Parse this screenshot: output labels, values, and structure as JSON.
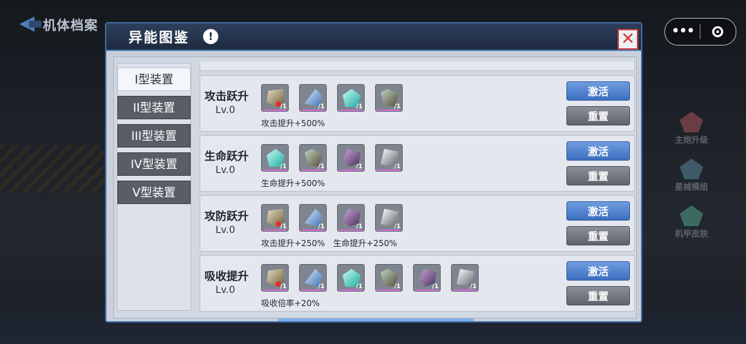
{
  "back": {
    "label": "机体档案"
  },
  "capsule": {
    "more_label": "•••"
  },
  "side_menu": [
    {
      "label": "主炮升级",
      "icon": "cannon-icon",
      "color": "#6a3d45"
    },
    {
      "label": "星械模组",
      "icon": "module-icon",
      "color": "#3f5a68"
    },
    {
      "label": "机甲皮肤",
      "icon": "skin-icon",
      "color": "#3d6a60"
    }
  ],
  "panel": {
    "title": "异能图鉴",
    "info_glyph": "!",
    "close_glyph": "✕",
    "tabs": [
      "I型装置",
      "II型装置",
      "III型装置",
      "IV型装置",
      "V型装置"
    ],
    "active_tab": "I型装置",
    "activate_label": "激活",
    "reset_label": "重置",
    "rows": [
      {
        "name": "攻击跃升",
        "level": "Lv.0",
        "items": [
          {
            "kind": "armor",
            "count": "/1",
            "alert": true
          },
          {
            "kind": "blade",
            "count": "/1"
          },
          {
            "kind": "crystal",
            "count": "/1"
          },
          {
            "kind": "claw",
            "count": "/1"
          }
        ],
        "bonuses": [
          "攻击提升+500%"
        ]
      },
      {
        "name": "生命跃升",
        "level": "Lv.0",
        "items": [
          {
            "kind": "crystal",
            "count": "/1"
          },
          {
            "kind": "claw",
            "count": "/1"
          },
          {
            "kind": "purple",
            "count": "/1"
          },
          {
            "kind": "steel",
            "count": "/1"
          }
        ],
        "bonuses": [
          "生命提升+500%"
        ]
      },
      {
        "name": "攻防跃升",
        "level": "Lv.0",
        "items": [
          {
            "kind": "armor",
            "count": "/1",
            "alert": true
          },
          {
            "kind": "blade",
            "count": "/1"
          },
          {
            "kind": "purple",
            "count": "/1"
          },
          {
            "kind": "steel",
            "count": "/1"
          }
        ],
        "bonuses": [
          "攻击提升+250%",
          "生命提升+250%"
        ]
      },
      {
        "name": "吸收提升",
        "level": "Lv.0",
        "items": [
          {
            "kind": "armor",
            "count": "/1",
            "alert": true
          },
          {
            "kind": "blade",
            "count": "/1"
          },
          {
            "kind": "crystal",
            "count": "/1"
          },
          {
            "kind": "claw",
            "count": "/1"
          },
          {
            "kind": "purple",
            "count": "/1"
          },
          {
            "kind": "steel",
            "count": "/1"
          }
        ],
        "bonuses": [
          "吸收倍率+20%"
        ]
      }
    ]
  }
}
